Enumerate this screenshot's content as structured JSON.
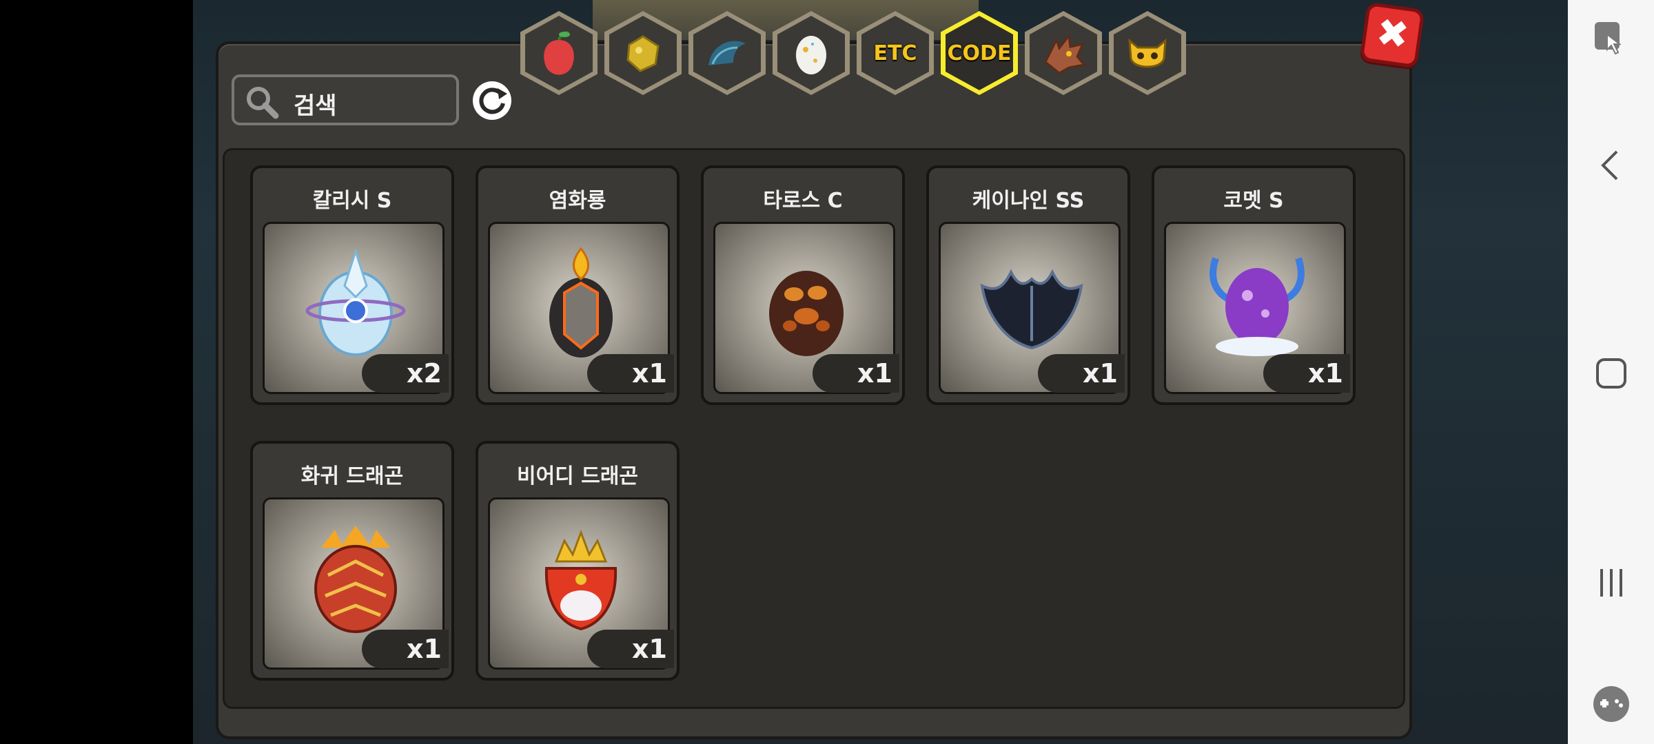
{
  "search": {
    "placeholder": "검색"
  },
  "tabs": [
    {
      "id": "fruit",
      "icon": "fruit-icon"
    },
    {
      "id": "gold",
      "icon": "gold-nugget-icon"
    },
    {
      "id": "claw",
      "icon": "claw-icon"
    },
    {
      "id": "egg",
      "icon": "egg-icon"
    },
    {
      "id": "etc",
      "label": "ETC"
    },
    {
      "id": "code",
      "label": "CODE",
      "active": true
    },
    {
      "id": "dragon",
      "icon": "dragon-head-icon"
    },
    {
      "id": "mask",
      "icon": "mask-icon"
    }
  ],
  "items": [
    {
      "name": "칼리시 S",
      "qty": "x2",
      "icon": "crystal-egg-icon"
    },
    {
      "name": "염화룡",
      "qty": "x1",
      "icon": "fire-dragon-egg-icon"
    },
    {
      "name": "타로스 C",
      "qty": "x1",
      "icon": "lava-egg-icon"
    },
    {
      "name": "케이나인 SS",
      "qty": "x1",
      "icon": "dark-egg-icon"
    },
    {
      "name": "코멧 S",
      "qty": "x1",
      "icon": "purple-egg-icon"
    },
    {
      "name": "화귀 드래곤",
      "qty": "x1",
      "icon": "flame-egg-icon"
    },
    {
      "name": "비어디 드래곤",
      "qty": "x1",
      "icon": "crown-egg-icon"
    }
  ],
  "colors": {
    "active_tab_border": "#f7ec2e",
    "close_button": "#e53030",
    "tab_text": "#f5c51d"
  }
}
